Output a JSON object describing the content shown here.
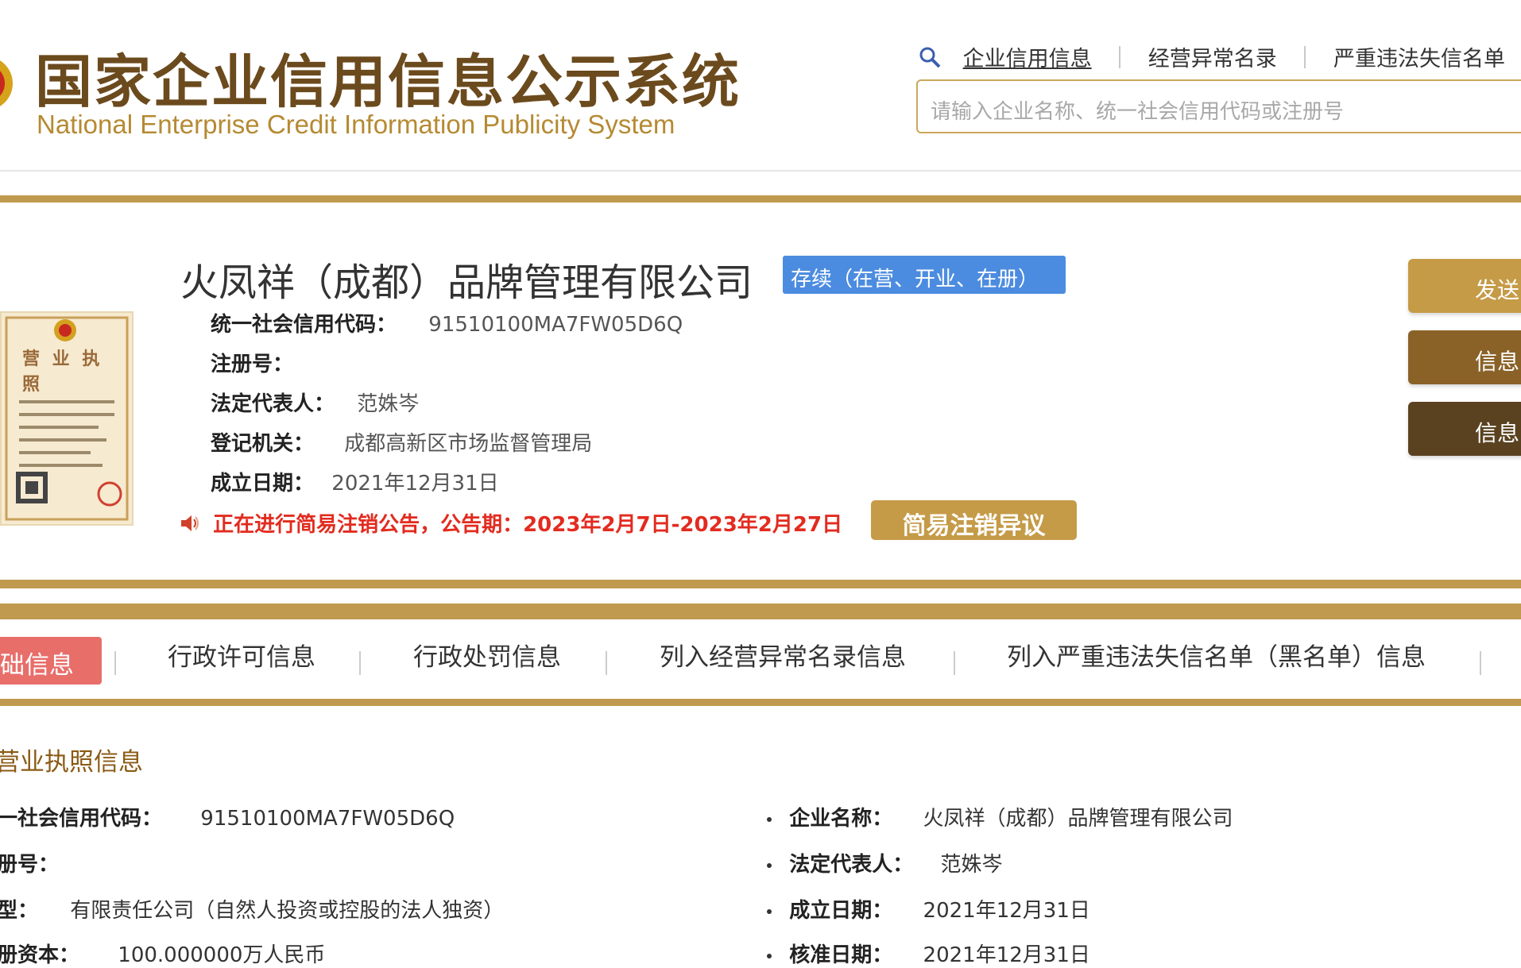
{
  "header": {
    "title_cn": "国家企业信用信息公示系统",
    "title_en": "National Enterprise Credit Information Publicity System",
    "nav": {
      "credit_info": "企业信用信息",
      "abnormal_list": "经营异常名录",
      "serious_list": "严重违法失信名单"
    },
    "search": {
      "placeholder": "请输入企业名称、统一社会信用代码或注册号"
    }
  },
  "company": {
    "name": "火凤祥（成都）品牌管理有限公司",
    "status": "存续（在营、开业、在册）",
    "uscc_label": "统一社会信用代码：",
    "uscc": "91510100MA7FW05D6Q",
    "reg_no_label": "注册号：",
    "reg_no": "",
    "legal_rep_label": "法定代表人：",
    "legal_rep": "范姝岑",
    "authority_label": "登记机关：",
    "authority": "成都高新区市场监督管理局",
    "est_date_label": "成立日期：",
    "est_date": "2021年12月31日",
    "notice": "正在进行简易注销公告，公告期：2023年2月7日-2023年2月27日",
    "objection_button": "简易注销异议",
    "license_image_text": "营 业 执 照"
  },
  "side_buttons": {
    "send": "发送",
    "info1": "信息",
    "info2": "信息"
  },
  "tabs": {
    "basic": "础信息",
    "admin_license": "行政许可信息",
    "admin_penalty": "行政处罚信息",
    "abnormal": "列入经营异常名录信息",
    "blacklist": "列入严重违法失信名单（黑名单）信息"
  },
  "section": {
    "title": "营业执照信息",
    "left": {
      "uscc_label": "一社会信用代码：",
      "uscc": "91510100MA7FW05D6Q",
      "reg_no_label": "册号：",
      "type_label": "型：",
      "type": "有限责任公司（自然人投资或控股的法人独资）",
      "capital_label": "册资本：",
      "capital": "100.000000万人民币"
    },
    "right": {
      "name_label": "企业名称：",
      "name": "火凤祥（成都）品牌管理有限公司",
      "legal_rep_label": "法定代表人：",
      "legal_rep": "范姝岑",
      "est_date_label": "成立日期：",
      "est_date": "2021年12月31日",
      "approve_label": "核准日期：",
      "approve_date": "2021年12月31日"
    }
  },
  "colors": {
    "gold": "#c09a4e",
    "brown": "#6b4a1d",
    "status_blue": "#4c8ce0",
    "alert_red": "#e22b1f",
    "tab_active": "#e86e6a"
  }
}
